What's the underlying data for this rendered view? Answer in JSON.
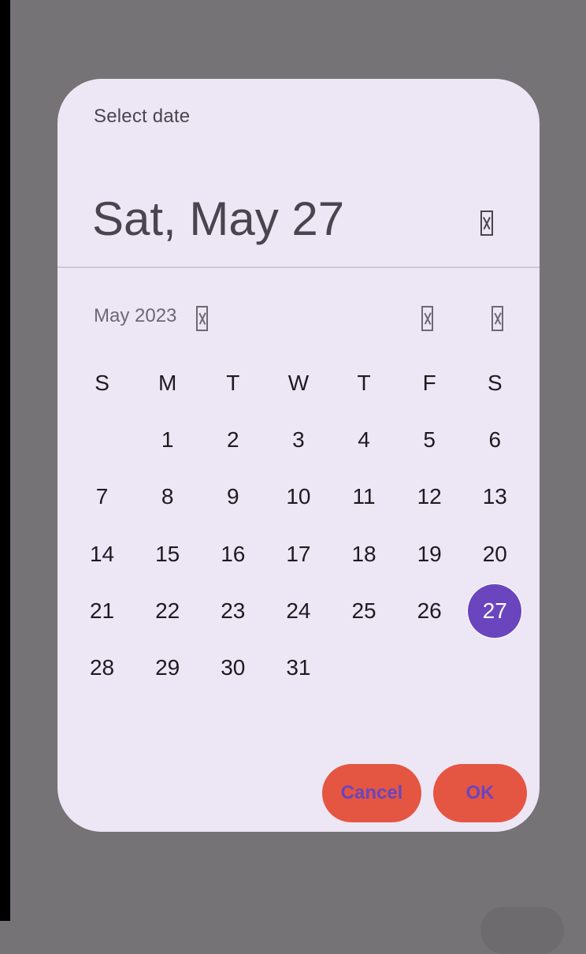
{
  "dialog": {
    "title": "Select date",
    "selected_date": "Sat, May 27",
    "month_year": "May 2023",
    "icons": {
      "edit": "edit-icon",
      "dropdown": "dropdown-icon",
      "prev": "chevron-left-icon",
      "next": "chevron-right-icon"
    },
    "weekdays": [
      "S",
      "M",
      "T",
      "W",
      "T",
      "F",
      "S"
    ],
    "weeks": [
      [
        "",
        "1",
        "2",
        "3",
        "4",
        "5",
        "6"
      ],
      [
        "7",
        "8",
        "9",
        "10",
        "11",
        "12",
        "13"
      ],
      [
        "14",
        "15",
        "16",
        "17",
        "18",
        "19",
        "20"
      ],
      [
        "21",
        "22",
        "23",
        "24",
        "25",
        "26",
        "27"
      ],
      [
        "28",
        "29",
        "30",
        "31",
        "",
        "",
        ""
      ]
    ],
    "selected_day": "27",
    "cancel_label": "Cancel",
    "ok_label": "OK"
  },
  "colors": {
    "scrim": "#757375",
    "dialog_bg": "#ede6f5",
    "accent": "#6a45bd",
    "button_bg": "#e45642"
  }
}
